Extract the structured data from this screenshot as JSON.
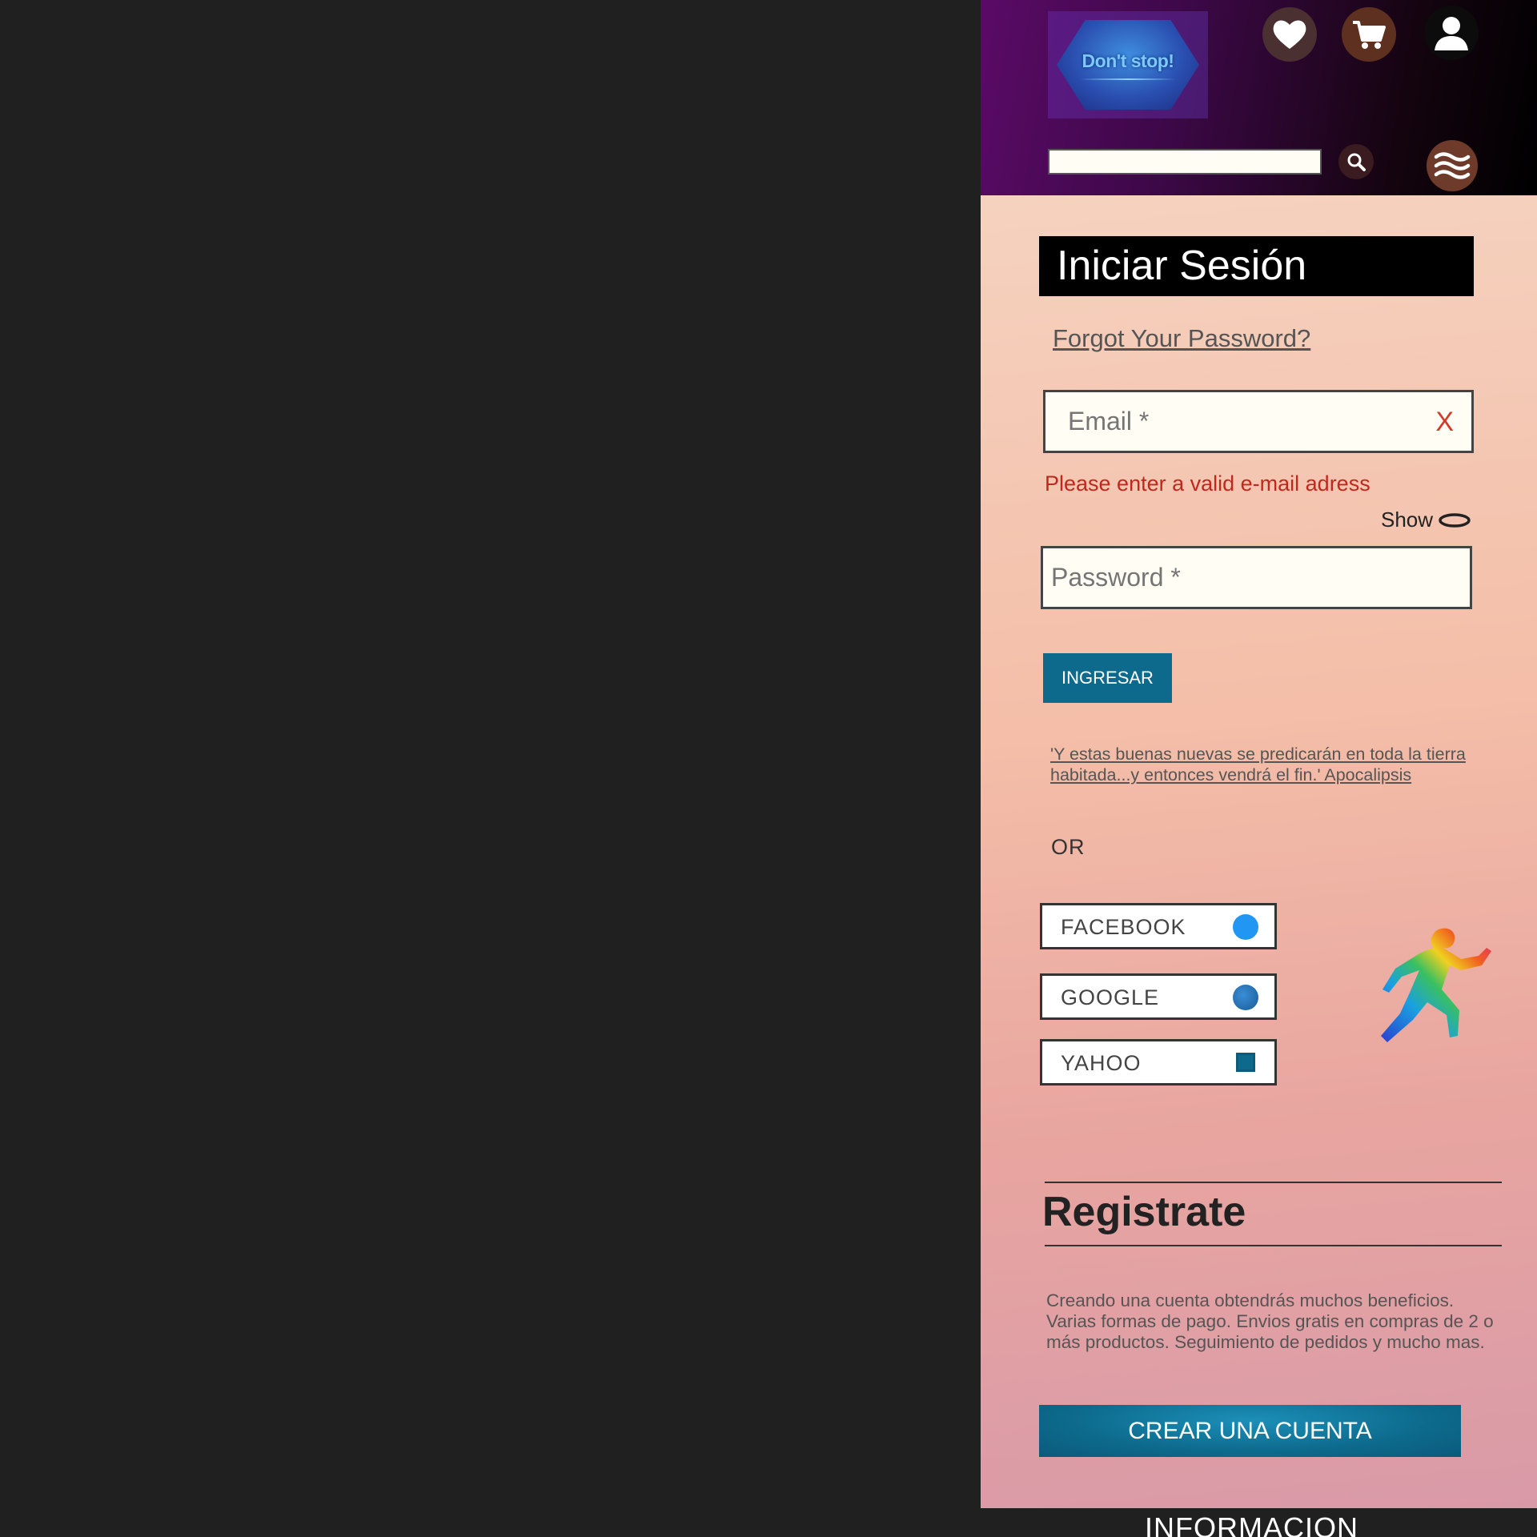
{
  "header": {
    "logo_text": "Don't stop!",
    "icons": {
      "wishlist": "heart-icon",
      "cart": "cart-icon",
      "account": "user-icon",
      "search": "search-icon",
      "menu": "menu-icon"
    },
    "search": {
      "value": "",
      "placeholder": ""
    }
  },
  "login": {
    "title": "Iniciar Sesión",
    "forgot_password": "Forgot Your Password?",
    "email": {
      "placeholder": "Email *",
      "value": "",
      "clear": "X"
    },
    "email_error": "Please enter a valid e-mail adress",
    "show_label": "Show",
    "password": {
      "placeholder": "Password *",
      "value": ""
    },
    "submit_label": "INGRESAR",
    "quote": "'Y estas buenas nuevas se predicarán en toda la tierra habitada...y entonces vendrá el fin.' Apocalipsis",
    "or_label": "OR",
    "social": [
      {
        "label": "FACEBOOK",
        "color": "#2196f3"
      },
      {
        "label": "GOOGLE",
        "color": "#2a7ab8"
      },
      {
        "label": "YAHOO",
        "color": "#0d6a8c"
      }
    ]
  },
  "register": {
    "title": "Registrate",
    "description": "Creando una cuenta obtendrás muchos beneficios. Varias formas de pago. Envios gratis en compras de 2 o más productos. Seguimiento de pedidos y mucho mas.",
    "button_label": "CREAR UNA CUENTA"
  },
  "footer": {
    "title": "INFORMACION"
  },
  "colors": {
    "accent": "#0d6a8c",
    "error": "#c0281e",
    "header_start": "#5a0a66",
    "header_end": "#000000"
  }
}
